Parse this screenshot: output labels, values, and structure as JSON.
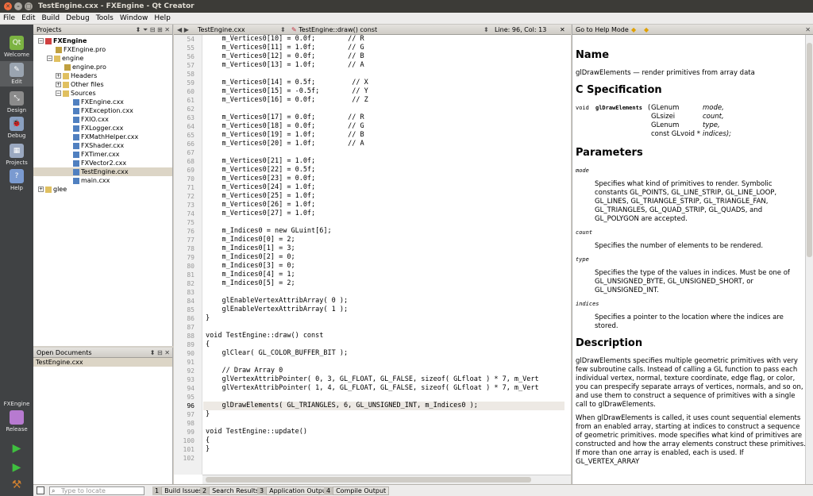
{
  "window": {
    "title": "TestEngine.cxx - FXEngine - Qt Creator"
  },
  "menu": [
    "File",
    "Edit",
    "Build",
    "Debug",
    "Tools",
    "Window",
    "Help"
  ],
  "modes": [
    {
      "label": "Welcome",
      "color": "#7cb342"
    },
    {
      "label": "Edit",
      "color": "#9aa4b0"
    },
    {
      "label": "Design",
      "color": "#8b8b8b"
    },
    {
      "label": "Debug",
      "color": "#8aa0c0"
    },
    {
      "label": "Projects",
      "color": "#9aa8c0"
    },
    {
      "label": "Help",
      "color": "#7a9ad0"
    }
  ],
  "target": {
    "project": "FXEngine",
    "mode": "Release"
  },
  "projects": {
    "header": "Projects",
    "tree": [
      {
        "label": "FXEngine",
        "depth": 0,
        "expanded": true,
        "bold": true,
        "icon": "project"
      },
      {
        "label": "FXEngine.pro",
        "depth": 1,
        "icon": "file"
      },
      {
        "label": "engine",
        "depth": 1,
        "expanded": true,
        "icon": "folder"
      },
      {
        "label": "engine.pro",
        "depth": 2,
        "icon": "file"
      },
      {
        "label": "Headers",
        "depth": 2,
        "expanded": false,
        "icon": "folder"
      },
      {
        "label": "Other files",
        "depth": 2,
        "expanded": false,
        "icon": "folder"
      },
      {
        "label": "Sources",
        "depth": 2,
        "expanded": true,
        "icon": "folder"
      },
      {
        "label": "FXEngine.cxx",
        "depth": 3,
        "icon": "cpp"
      },
      {
        "label": "FXException.cxx",
        "depth": 3,
        "icon": "cpp"
      },
      {
        "label": "FXIO.cxx",
        "depth": 3,
        "icon": "cpp"
      },
      {
        "label": "FXLogger.cxx",
        "depth": 3,
        "icon": "cpp"
      },
      {
        "label": "FXMathHelper.cxx",
        "depth": 3,
        "icon": "cpp"
      },
      {
        "label": "FXShader.cxx",
        "depth": 3,
        "icon": "cpp"
      },
      {
        "label": "FXTimer.cxx",
        "depth": 3,
        "icon": "cpp"
      },
      {
        "label": "FXVector2.cxx",
        "depth": 3,
        "icon": "cpp"
      },
      {
        "label": "TestEngine.cxx",
        "depth": 3,
        "icon": "cpp",
        "selected": true
      },
      {
        "label": "main.cxx",
        "depth": 3,
        "icon": "cpp"
      },
      {
        "label": "glee",
        "depth": 0,
        "expanded": false,
        "icon": "folder"
      }
    ]
  },
  "open_documents": {
    "header": "Open Documents",
    "items": [
      "TestEngine.cxx"
    ]
  },
  "editor": {
    "file": "TestEngine.cxx",
    "symbol": "TestEngine::draw() const",
    "position": "Line: 96, Col: 13",
    "current_line": 96,
    "lines": [
      {
        "n": 54,
        "t": "    m_Vertices0[10] = 0.0f;        // R"
      },
      {
        "n": 55,
        "t": "    m_Vertices0[11] = 1.0f;        // G"
      },
      {
        "n": 56,
        "t": "    m_Vertices0[12] = 0.0f;        // B"
      },
      {
        "n": 57,
        "t": "    m_Vertices0[13] = 1.0f;        // A"
      },
      {
        "n": 58,
        "t": ""
      },
      {
        "n": 59,
        "t": "    m_Vertices0[14] = 0.5f;         // X"
      },
      {
        "n": 60,
        "t": "    m_Vertices0[15] = -0.5f;        // Y"
      },
      {
        "n": 61,
        "t": "    m_Vertices0[16] = 0.0f;         // Z"
      },
      {
        "n": 62,
        "t": ""
      },
      {
        "n": 63,
        "t": "    m_Vertices0[17] = 0.0f;        // R"
      },
      {
        "n": 64,
        "t": "    m_Vertices0[18] = 0.0f;        // G"
      },
      {
        "n": 65,
        "t": "    m_Vertices0[19] = 1.0f;        // B"
      },
      {
        "n": 66,
        "t": "    m_Vertices0[20] = 1.0f;        // A"
      },
      {
        "n": 67,
        "t": ""
      },
      {
        "n": 68,
        "t": "    m_Vertices0[21] = 1.0f;"
      },
      {
        "n": 69,
        "t": "    m_Vertices0[22] = 0.5f;"
      },
      {
        "n": 70,
        "t": "    m_Vertices0[23] = 0.0f;"
      },
      {
        "n": 71,
        "t": "    m_Vertices0[24] = 1.0f;"
      },
      {
        "n": 72,
        "t": "    m_Vertices0[25] = 1.0f;"
      },
      {
        "n": 73,
        "t": "    m_Vertices0[26] = 1.0f;"
      },
      {
        "n": 74,
        "t": "    m_Vertices0[27] = 1.0f;"
      },
      {
        "n": 75,
        "t": ""
      },
      {
        "n": 76,
        "t": "    m_Indices0 = new GLuint[6];"
      },
      {
        "n": 77,
        "t": "    m_Indices0[0] = 2;"
      },
      {
        "n": 78,
        "t": "    m_Indices0[1] = 3;"
      },
      {
        "n": 79,
        "t": "    m_Indices0[2] = 0;"
      },
      {
        "n": 80,
        "t": "    m_Indices0[3] = 0;"
      },
      {
        "n": 81,
        "t": "    m_Indices0[4] = 1;"
      },
      {
        "n": 82,
        "t": "    m_Indices0[5] = 2;"
      },
      {
        "n": 83,
        "t": ""
      },
      {
        "n": 84,
        "t": "    glEnableVertexAttribArray( 0 );"
      },
      {
        "n": 85,
        "t": "    glEnableVertexAttribArray( 1 );"
      },
      {
        "n": 86,
        "t": "}"
      },
      {
        "n": 87,
        "t": ""
      },
      {
        "n": 88,
        "t": "void TestEngine::draw() const"
      },
      {
        "n": 89,
        "t": "{"
      },
      {
        "n": 90,
        "t": "    glClear( GL_COLOR_BUFFER_BIT );"
      },
      {
        "n": 91,
        "t": ""
      },
      {
        "n": 92,
        "t": "    // Draw Array 0"
      },
      {
        "n": 93,
        "t": "    glVertexAttribPointer( 0, 3, GL_FLOAT, GL_FALSE, sizeof( GLfloat ) * 7, m_Vert"
      },
      {
        "n": 94,
        "t": "    glVertexAttribPointer( 1, 4, GL_FLOAT, GL_FALSE, sizeof( GLfloat ) * 7, m_Vert"
      },
      {
        "n": 95,
        "t": ""
      },
      {
        "n": 96,
        "t": "    glDrawElements( GL_TRIANGLES, 6, GL_UNSIGNED_INT, m_Indices0 );"
      },
      {
        "n": 97,
        "t": "}"
      },
      {
        "n": 98,
        "t": ""
      },
      {
        "n": 99,
        "t": "void TestEngine::update()"
      },
      {
        "n": 100,
        "t": "{"
      },
      {
        "n": 101,
        "t": "}"
      },
      {
        "n": 102,
        "t": ""
      }
    ]
  },
  "help": {
    "header": "Go to Help Mode",
    "name_h": "Name",
    "name_body": "glDrawElements — render primitives from array data",
    "spec_h": "C Specification",
    "spec": {
      "ret": "void",
      "fn": "glDrawElements",
      "args": [
        [
          "GLenum",
          "mode,"
        ],
        [
          "GLsizei",
          "count,"
        ],
        [
          "GLenum",
          "type,"
        ],
        [
          "const GLvoid *",
          "indices);"
        ]
      ]
    },
    "params_h": "Parameters",
    "params": [
      {
        "name": "mode",
        "desc": "Specifies what kind of primitives to render. Symbolic constants GL_POINTS, GL_LINE_STRIP, GL_LINE_LOOP, GL_LINES, GL_TRIANGLE_STRIP, GL_TRIANGLE_FAN, GL_TRIANGLES, GL_QUAD_STRIP, GL_QUADS, and GL_POLYGON are accepted."
      },
      {
        "name": "count",
        "desc": "Specifies the number of elements to be rendered."
      },
      {
        "name": "type",
        "desc": "Specifies the type of the values in indices. Must be one of GL_UNSIGNED_BYTE, GL_UNSIGNED_SHORT, or GL_UNSIGNED_INT."
      },
      {
        "name": "indices",
        "desc": "Specifies a pointer to the location where the indices are stored."
      }
    ],
    "desc_h": "Description",
    "desc_p1": "glDrawElements specifies multiple geometric primitives with very few subroutine calls. Instead of calling a GL function to pass each individual vertex, normal, texture coordinate, edge flag, or color, you can prespecify separate arrays of vertices, normals, and so on, and use them to construct a sequence of primitives with a single call to glDrawElements.",
    "desc_p2": "When glDrawElements is called, it uses count sequential elements from an enabled array, starting at indices to construct a sequence of geometric primitives. mode specifies what kind of primitives are constructed and how the array elements construct these primitives. If more than one array is enabled, each is used. If GL_VERTEX_ARRAY"
  },
  "statusbar": {
    "locate_placeholder": "Type to locate",
    "panes": [
      {
        "n": "1",
        "label": "Build Issues"
      },
      {
        "n": "2",
        "label": "Search Results"
      },
      {
        "n": "3",
        "label": "Application Output"
      },
      {
        "n": "4",
        "label": "Compile Output"
      }
    ]
  }
}
